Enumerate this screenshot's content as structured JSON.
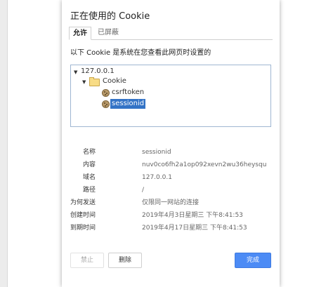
{
  "dialog": {
    "title": "正在使用的 Cookie",
    "tabs": [
      {
        "label": "允许",
        "active": true
      },
      {
        "label": "已屏蔽",
        "active": false
      }
    ],
    "description": "以下 Cookie 是系统在您查看此网页时设置的",
    "tree": {
      "host": "127.0.0.1",
      "folder": "Cookie",
      "items": [
        "csrftoken",
        "sessionid"
      ],
      "selected": "sessionid"
    },
    "details": [
      {
        "label": "名称",
        "value": "sessionid"
      },
      {
        "label": "内容",
        "value": "nuv0co6fh2a1op092xevn2wu36heysqu"
      },
      {
        "label": "域名",
        "value": "127.0.0.1"
      },
      {
        "label": "路径",
        "value": "/"
      },
      {
        "label": "为何发送",
        "value": "仅限同一网站的连接"
      },
      {
        "label": "创建时间",
        "value": "2019年4月3日星期三 下午8:41:53"
      },
      {
        "label": "到期时间",
        "value": "2019年4月17日星期三 下午8:41:53"
      }
    ],
    "buttons": {
      "block": "禁止",
      "delete": "删除",
      "done": "完成"
    }
  }
}
